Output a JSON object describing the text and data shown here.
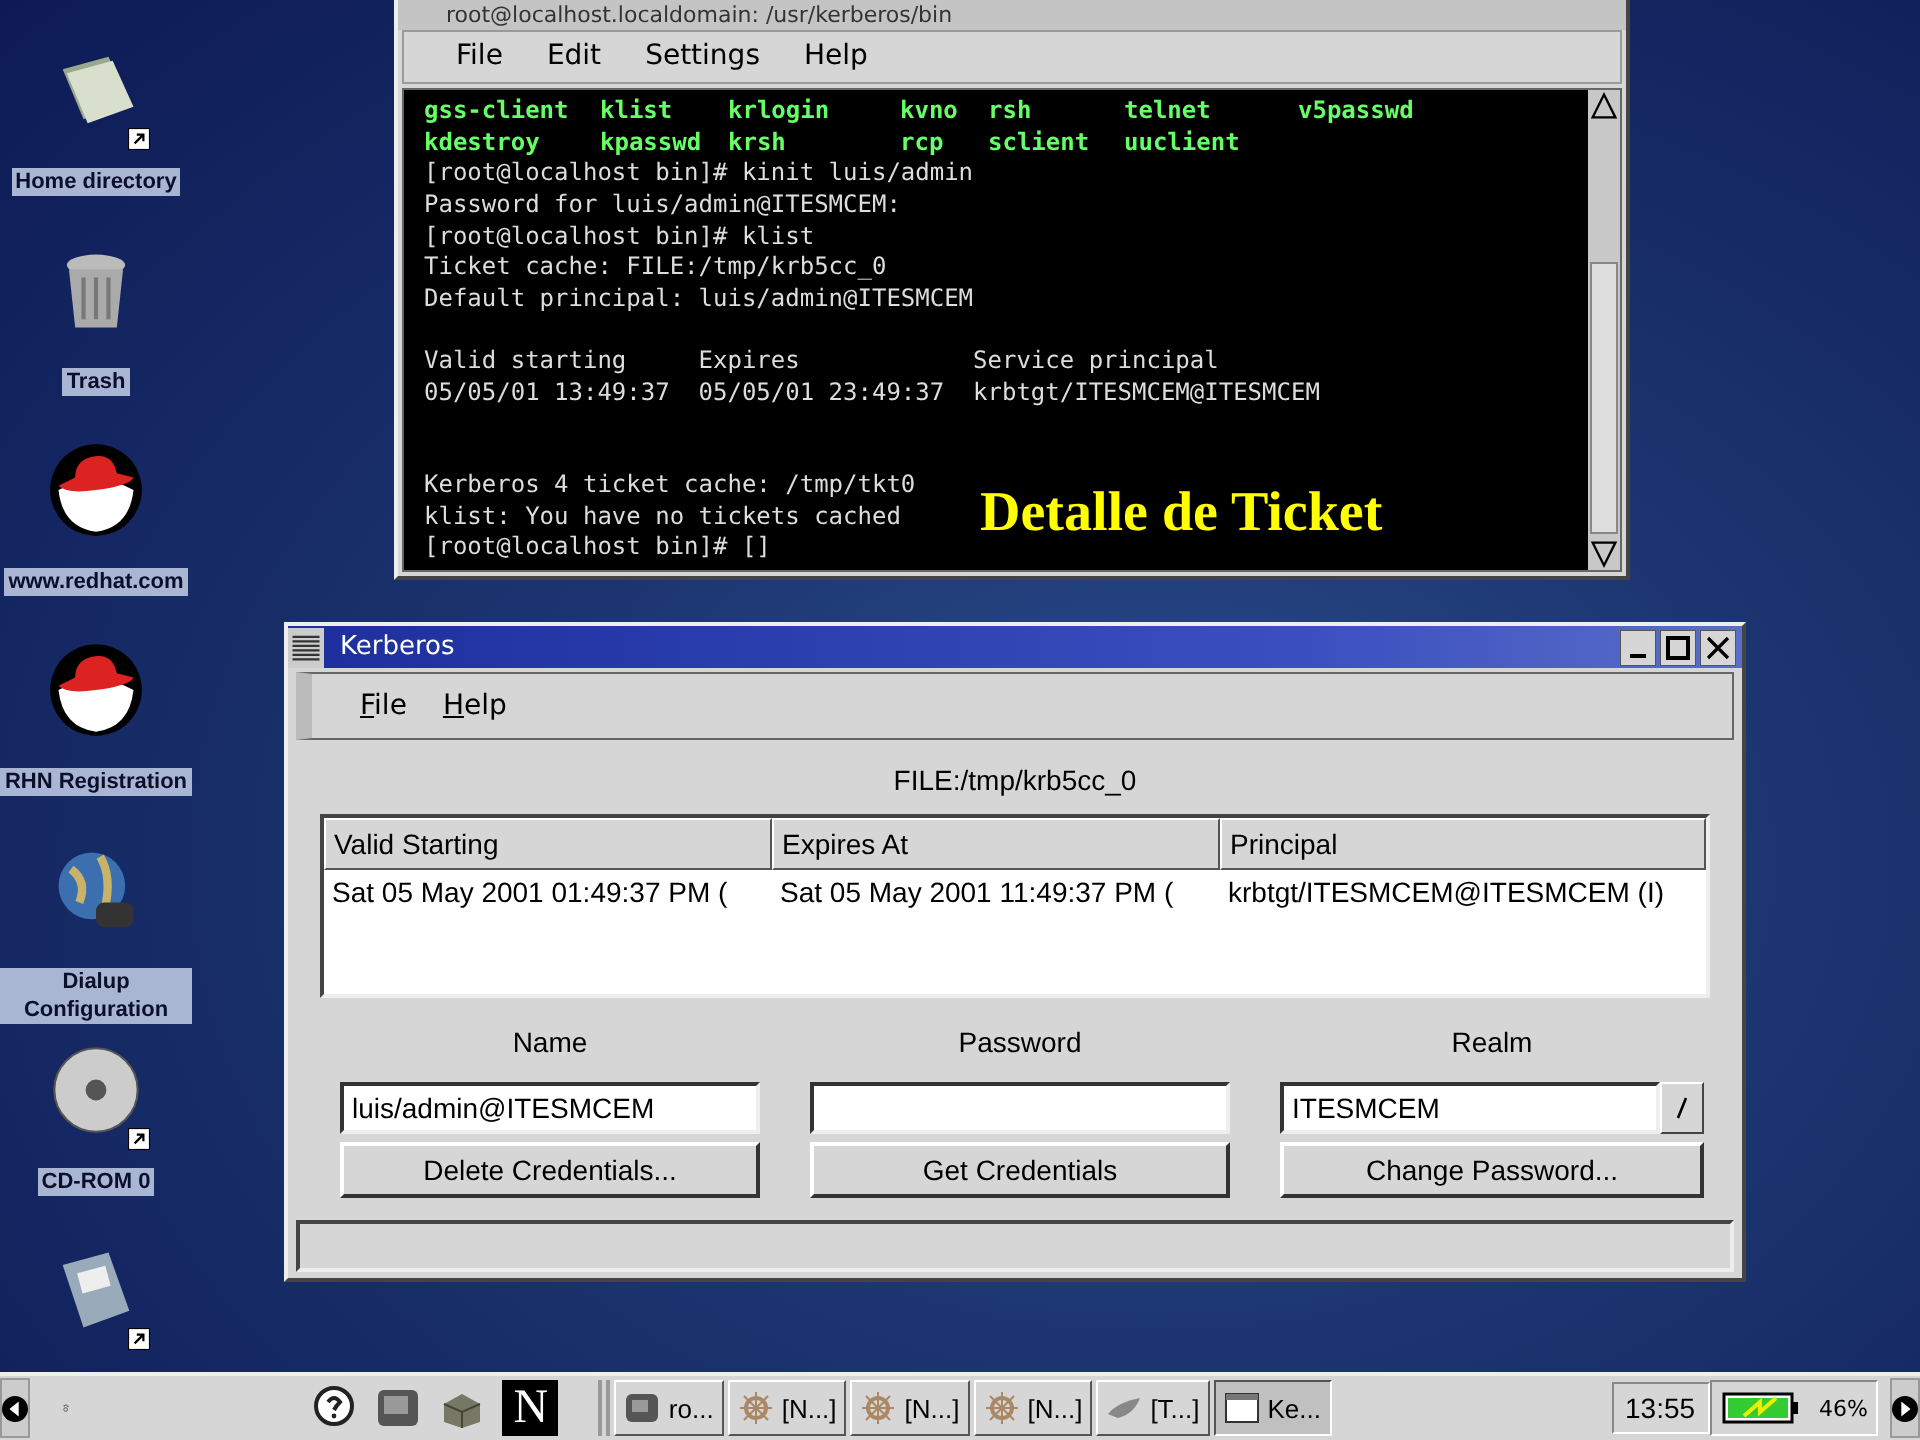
{
  "desktop_icons": [
    {
      "label": "Home directory",
      "kind": "folder",
      "shortcut": true
    },
    {
      "label": "Trash",
      "kind": "trash",
      "shortcut": false
    },
    {
      "label": "www.redhat.com",
      "kind": "hat",
      "shortcut": false
    },
    {
      "label": "RHN Registration",
      "kind": "hat",
      "shortcut": false
    },
    {
      "label": "Dialup Configuration",
      "kind": "globe",
      "shortcut": false
    },
    {
      "label": "CD-ROM 0",
      "kind": "disc",
      "shortcut": true
    },
    {
      "kind": "floppy",
      "shortcut": true
    }
  ],
  "terminal_window": {
    "title": "root@localhost.localdomain: /usr/kerberos/bin",
    "menu": [
      "File",
      "Edit",
      "Settings",
      "Help"
    ],
    "listing": [
      [
        "gss-client",
        "klist",
        "krlogin",
        "kvno",
        "rsh",
        "telnet",
        "v5passwd"
      ],
      [
        "kdestroy",
        "kpasswd",
        "krsh",
        "rcp",
        "sclient",
        "uuclient"
      ]
    ],
    "blocks": [
      [
        "[root@localhost bin]# kinit luis/admin",
        "Password for luis/admin@ITESMCEM:",
        "[root@localhost bin]# klist",
        "Ticket cache: FILE:/tmp/krb5cc_0",
        "Default principal: luis/admin@ITESMCEM"
      ],
      [
        "Valid starting     Expires            Service principal",
        "05/05/01 13:49:37  05/05/01 23:49:37  krbtgt/ITESMCEM@ITESMCEM"
      ],
      [
        "Kerberos 4 ticket cache: /tmp/tkt0",
        "klist: You have no tickets cached",
        "[root@localhost bin]# []"
      ]
    ]
  },
  "overlay_caption": "Detalle de Ticket",
  "kerberos_window": {
    "title": "Kerberos",
    "menu": [
      "File",
      "Help"
    ],
    "cache_label": "FILE:/tmp/krb5cc_0",
    "table": {
      "columns": [
        "Valid Starting",
        "Expires At",
        "Principal"
      ],
      "rows": [
        [
          "Sat 05 May 2001 01:49:37 PM (",
          "Sat 05 May 2001 11:49:37 PM (",
          "krbtgt/ITESMCEM@ITESMCEM (I)"
        ]
      ]
    },
    "fields": [
      {
        "label": "Name",
        "kind": "text",
        "value": "luis/admin@ITESMCEM"
      },
      {
        "label": "Password",
        "kind": "password"
      },
      {
        "label": "Realm",
        "kind": "combo",
        "value": "ITESMCEM"
      }
    ],
    "buttons": [
      "Delete Credentials...",
      "Get Credentials",
      "Change Password..."
    ]
  },
  "taskbar": {
    "launchers": [
      {
        "kind": "help"
      },
      {
        "kind": "monitor"
      },
      {
        "kind": "package"
      },
      {
        "kind": "netscape",
        "text": "N"
      }
    ],
    "tasks": [
      {
        "label": "ro...",
        "kind": "terminal",
        "selected": false
      },
      {
        "label": "[N...]",
        "kind": "wheel",
        "selected": false
      },
      {
        "label": "[N...]",
        "kind": "wheel",
        "selected": false
      },
      {
        "label": "[N...]",
        "kind": "wheel",
        "selected": false
      },
      {
        "label": "[T...]",
        "kind": "gimp",
        "selected": false
      },
      {
        "label": "Ke...",
        "kind": "window",
        "selected": true
      }
    ],
    "clock": "13:55",
    "battery_reading": "46%"
  }
}
